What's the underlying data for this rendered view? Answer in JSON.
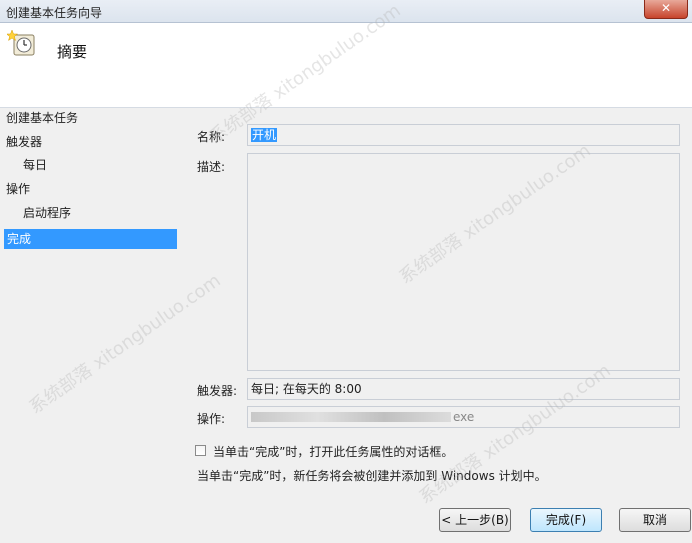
{
  "window": {
    "title": "创建基本任务向导",
    "close_label": "✕"
  },
  "header": {
    "heading": "摘要",
    "icon": "task-clock-icon"
  },
  "sidebar": {
    "items": [
      {
        "label": "创建基本任务",
        "level": 0,
        "active": false
      },
      {
        "label": "触发器",
        "level": 0,
        "active": false
      },
      {
        "label": "每日",
        "level": 1,
        "active": false
      },
      {
        "label": "操作",
        "level": 0,
        "active": false
      },
      {
        "label": "启动程序",
        "level": 1,
        "active": false
      },
      {
        "label": "完成",
        "level": 0,
        "active": true
      }
    ]
  },
  "form": {
    "name_label": "名称:",
    "name_value": "开机",
    "description_label": "描述:",
    "description_value": "",
    "trigger_label": "触发器:",
    "trigger_value": "每日; 在每天的 8:00",
    "action_label": "操作:",
    "action_value": "exe",
    "open_properties_checked": false,
    "open_properties_label": "当单击“完成”时，打开此任务属性的对话框。",
    "info_text": "当单击“完成”时，新任务将会被创建并添加到 Windows 计划中。"
  },
  "buttons": {
    "back": "< 上一步(B)",
    "finish": "完成(F)",
    "cancel": "取消"
  },
  "watermark": "系统部落 xitongbuluo.com"
}
